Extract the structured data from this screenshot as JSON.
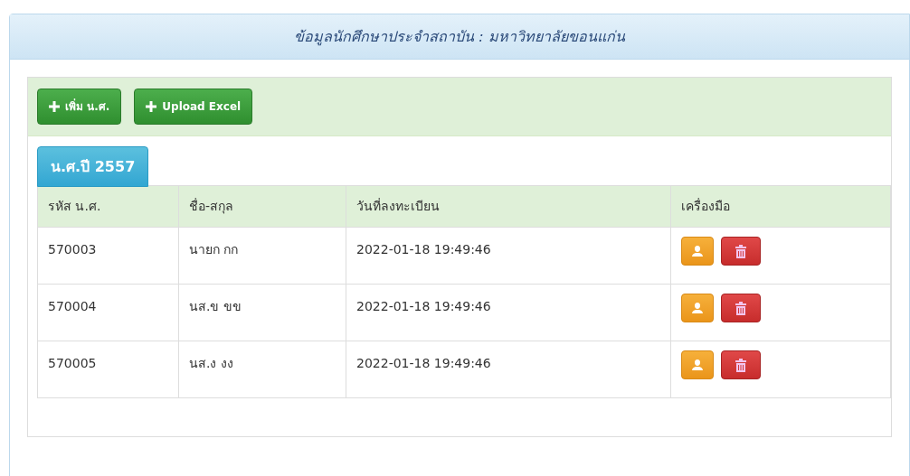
{
  "panel": {
    "title": "ข้อมูลนักศึกษาประจำสถาบัน : มหาวิทยาลัยขอนแก่น"
  },
  "toolbar": {
    "buttons": [
      {
        "label": "เพิ่ม น.ศ."
      },
      {
        "label": "Upload Excel"
      }
    ]
  },
  "tabs": [
    {
      "label": "น.ศ.ปี 2557",
      "selected": true
    }
  ],
  "table": {
    "columns": [
      "รหัส น.ศ.",
      "ชื่อ-สกุล",
      "วันที่ลงทะเบียน",
      "เครื่องมือ"
    ],
    "rows": [
      [
        "570003",
        "นายก กก",
        "2022-01-18 19:49:46"
      ],
      [
        "570004",
        "นส.ข ขข",
        "2022-01-18 19:49:46"
      ],
      [
        "570005",
        "นส.ง งง",
        "2022-01-18 19:49:46"
      ]
    ]
  }
}
